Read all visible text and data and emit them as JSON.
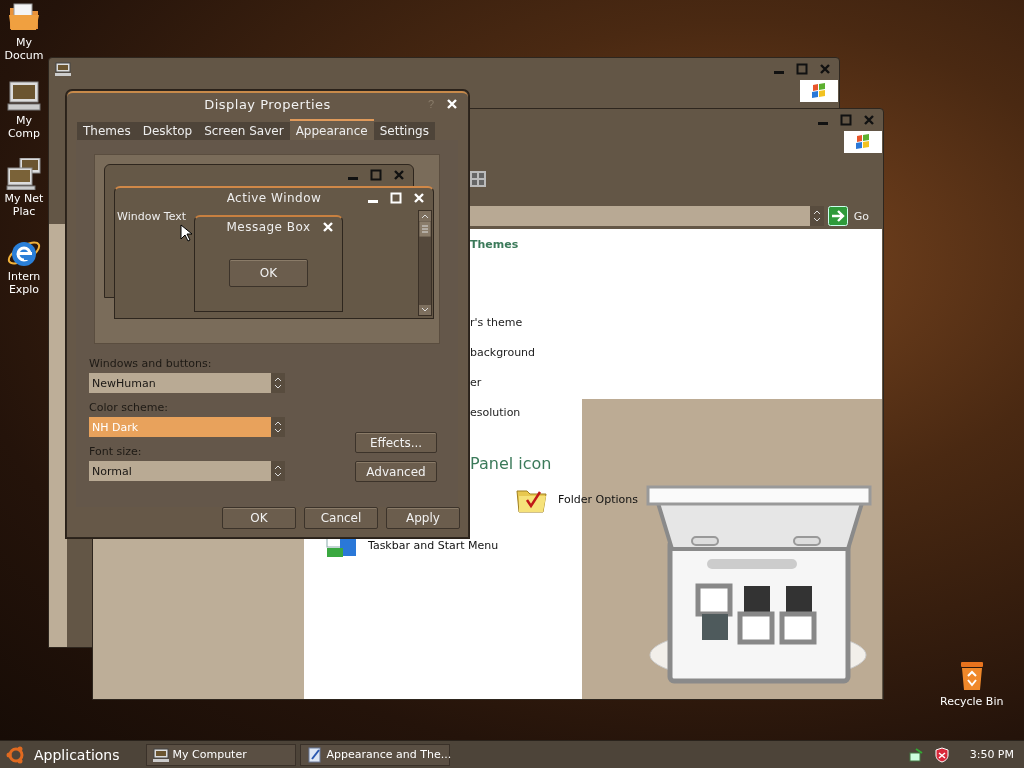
{
  "desktop": {
    "icons": [
      {
        "kind": "documents",
        "label": "My Docum"
      },
      {
        "kind": "computer",
        "label": "My Comp"
      },
      {
        "kind": "network",
        "label": "My Net Plac"
      },
      {
        "kind": "browser",
        "label": "Intern Explo"
      }
    ],
    "recycle_bin": {
      "label": "Recycle Bin"
    }
  },
  "control_panel": {
    "address_go": "Go",
    "section_heading": "Themes",
    "tasks": [
      "r's theme",
      "background",
      "er",
      "esolution"
    ],
    "panel_heading": "Panel icon",
    "items": [
      {
        "kind": "folder_options",
        "label": "Folder Options"
      },
      {
        "kind": "taskbar",
        "label": "Taskbar and Start Menu"
      }
    ]
  },
  "dialog": {
    "title": "Display Properties",
    "help": "?",
    "tabs": [
      {
        "label": "Themes",
        "selected": false
      },
      {
        "label": "Desktop",
        "selected": false
      },
      {
        "label": "Screen Saver",
        "selected": false
      },
      {
        "label": "Appearance",
        "selected": true
      },
      {
        "label": "Settings",
        "selected": false
      }
    ],
    "preview": {
      "active_title": "Active Window",
      "window_text": "Window Text",
      "message_title": "Message Box",
      "message_button": "OK"
    },
    "fields": [
      {
        "label": "Windows and buttons:",
        "value": "NewHuman",
        "highlighted": false
      },
      {
        "label": "Color scheme:",
        "value": "NH Dark",
        "highlighted": true
      },
      {
        "label": "Font size:",
        "value": "Normal",
        "highlighted": false
      }
    ],
    "side_buttons": [
      "Effects...",
      "Advanced"
    ],
    "buttons": [
      "OK",
      "Cancel",
      "Apply"
    ]
  },
  "taskbar": {
    "menu": "Applications",
    "tasks": [
      {
        "kind": "computer",
        "label": "My Computer"
      },
      {
        "kind": "document",
        "label": "Appearance and The..."
      }
    ],
    "clock": "3:50 PM"
  }
}
